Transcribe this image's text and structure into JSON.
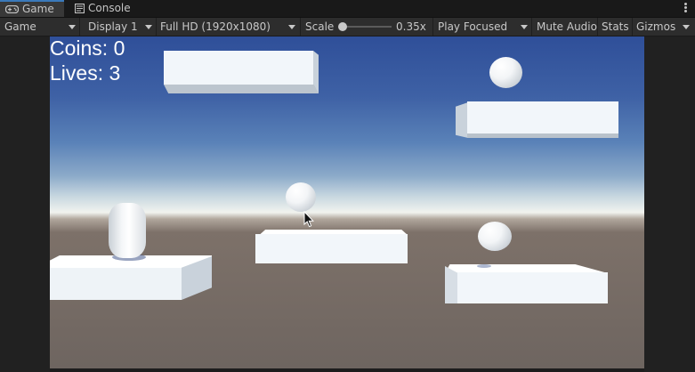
{
  "tabs": [
    {
      "id": "game",
      "label": "Game",
      "icon": "gamepad-icon",
      "active": true
    },
    {
      "id": "console",
      "label": "Console",
      "icon": "console-icon",
      "active": false
    }
  ],
  "toolbar": {
    "view_mode": "Game",
    "display": "Display 1",
    "resolution": "Full HD (1920x1080)",
    "scale_label": "Scale",
    "scale_value": "0.35x",
    "scale_fraction": 0.35,
    "play_mode": "Play Focused",
    "mute_audio": "Mute Audio",
    "stats": "Stats",
    "gizmos": "Gizmos"
  },
  "hud": {
    "coins": "Coins: 0",
    "lives": "Lives: 3"
  },
  "colors": {
    "accent": "#3a79bb",
    "panel": "#2d2d2d",
    "tab_bar": "#191919",
    "sky_top": "#2f4f99",
    "ground": "#6e6560"
  }
}
